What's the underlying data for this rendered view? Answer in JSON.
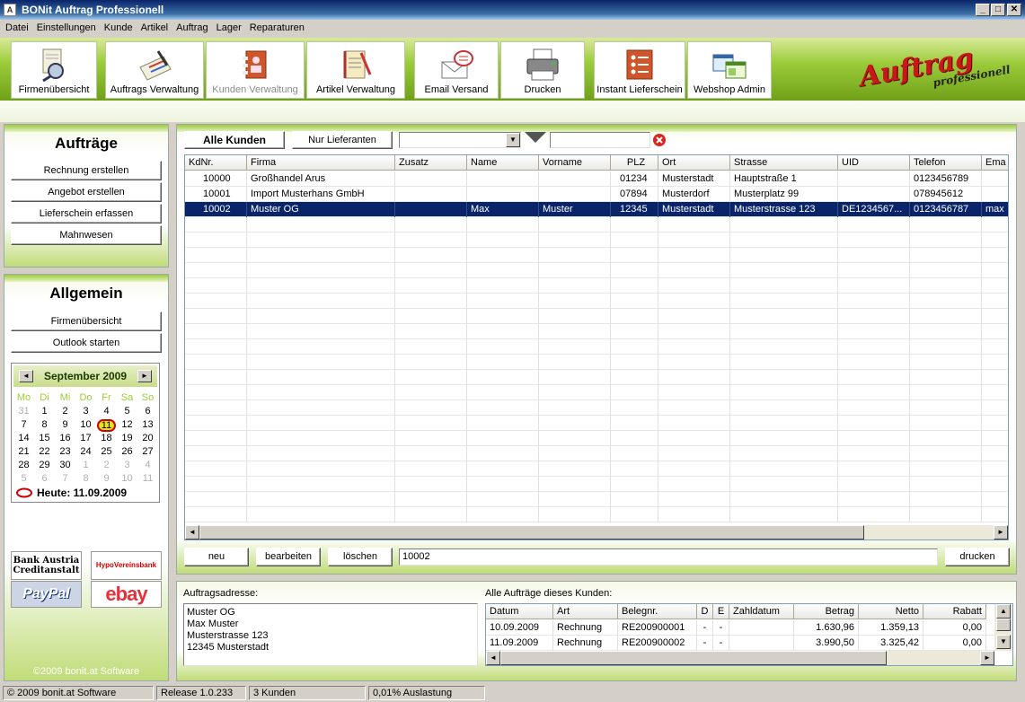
{
  "window": {
    "title": "BONit Auftrag Professionell",
    "min": "_",
    "max": "□",
    "close": "✕"
  },
  "menu": [
    "Datei",
    "Einstellungen",
    "Kunde",
    "Artikel",
    "Auftrag",
    "Lager",
    "Reparaturen"
  ],
  "toolbar": [
    {
      "label": "Firmenübersicht",
      "icon": "magnifier-icon",
      "disabled": false
    },
    {
      "label": "Auftrags Verwaltung",
      "icon": "document-pen-icon",
      "disabled": false
    },
    {
      "label": "Kunden Verwaltung",
      "icon": "address-card-icon",
      "disabled": true
    },
    {
      "label": "Artikel Verwaltung",
      "icon": "notebook-icon",
      "disabled": false
    },
    {
      "label": "Email Versand",
      "icon": "email-icon",
      "disabled": false
    },
    {
      "label": "Drucken",
      "icon": "printer-icon",
      "disabled": false
    },
    {
      "label": "Instant Lieferschein",
      "icon": "checklist-icon",
      "disabled": false
    },
    {
      "label": "Webshop Admin",
      "icon": "webshop-icon",
      "disabled": false
    }
  ],
  "logo": {
    "main": "Auftrag",
    "sub": "professionell"
  },
  "left": {
    "auftraege_title": "Aufträge",
    "auftraege_buttons": [
      "Rechnung erstellen",
      "Angebot erstellen",
      "Lieferschein erfassen",
      "Mahnwesen"
    ],
    "allgemein_title": "Allgemein",
    "allgemein_buttons": [
      "Firmenübersicht",
      "Outlook starten"
    ],
    "calendar": {
      "month": "September 2009",
      "prev": "◄",
      "next": "►",
      "daynames": [
        "Mo",
        "Di",
        "Mi",
        "Do",
        "Fr",
        "Sa",
        "So"
      ],
      "weeks": [
        [
          "31",
          "1",
          "2",
          "3",
          "4",
          "5",
          "6"
        ],
        [
          "7",
          "8",
          "9",
          "10",
          "11",
          "12",
          "13"
        ],
        [
          "14",
          "15",
          "16",
          "17",
          "18",
          "19",
          "20"
        ],
        [
          "21",
          "22",
          "23",
          "24",
          "25",
          "26",
          "27"
        ],
        [
          "28",
          "29",
          "30",
          "1",
          "2",
          "3",
          "4"
        ],
        [
          "5",
          "6",
          "7",
          "8",
          "9",
          "10",
          "11"
        ]
      ],
      "today_label": "Heute: 11.09.2009"
    },
    "banks": [
      "Bank Austria Creditanstalt",
      "HypoVereinsbank",
      "PayPal",
      "ebay"
    ],
    "copyright": "©2009 bonit.at Software"
  },
  "filters": {
    "all": "Alle Kunden",
    "suppliers": "Nur Lieferanten",
    "search_value": ""
  },
  "grid": {
    "columns": [
      "KdNr.",
      "Firma",
      "Zusatz",
      "Name",
      "Vorname",
      "PLZ",
      "Ort",
      "Strasse",
      "UID",
      "Telefon",
      "Ema"
    ],
    "rows": [
      [
        "10000",
        "Großhandel Arus",
        "",
        "",
        "",
        "01234",
        "Musterstadt",
        "Hauptstraße 1",
        "",
        "0123456789",
        ""
      ],
      [
        "10001",
        "Import Musterhans GmbH",
        "",
        "",
        "",
        "07894",
        "Musterdorf",
        "Musterplatz 99",
        "",
        "078945612",
        ""
      ],
      [
        "10002",
        "Muster OG",
        "",
        "Max",
        "Muster",
        "12345",
        "Musterstadt",
        "Musterstrasse 123",
        "DE1234567...",
        "0123456787",
        "max"
      ]
    ],
    "selected_index": 2
  },
  "actions": {
    "new": "neu",
    "edit": "bearbeiten",
    "delete": "löschen",
    "current": "10002",
    "print": "drucken"
  },
  "bottom": {
    "address_label": "Auftragsadresse:",
    "address_lines": [
      "Muster OG",
      "Max Muster",
      "Musterstrasse 123",
      "12345 Musterstadt"
    ],
    "orders_label": "Alle Aufträge dieses Kunden:",
    "order_columns": [
      "Datum",
      "Art",
      "Belegnr.",
      "D",
      "E",
      "Zahldatum",
      "Betrag",
      "Netto",
      "Rabatt"
    ],
    "orders": [
      [
        "10.09.2009",
        "Rechnung",
        "RE200900001",
        "-",
        "-",
        "",
        "1.630,96",
        "1.359,13",
        "0,00"
      ],
      [
        "11.09.2009",
        "Rechnung",
        "RE200900002",
        "-",
        "-",
        "",
        "3.990,50",
        "3.325,42",
        "0,00"
      ]
    ]
  },
  "status": [
    "© 2009 bonit.at Software",
    "Release 1.0.233",
    "3 Kunden",
    "0,01% Auslastung"
  ]
}
